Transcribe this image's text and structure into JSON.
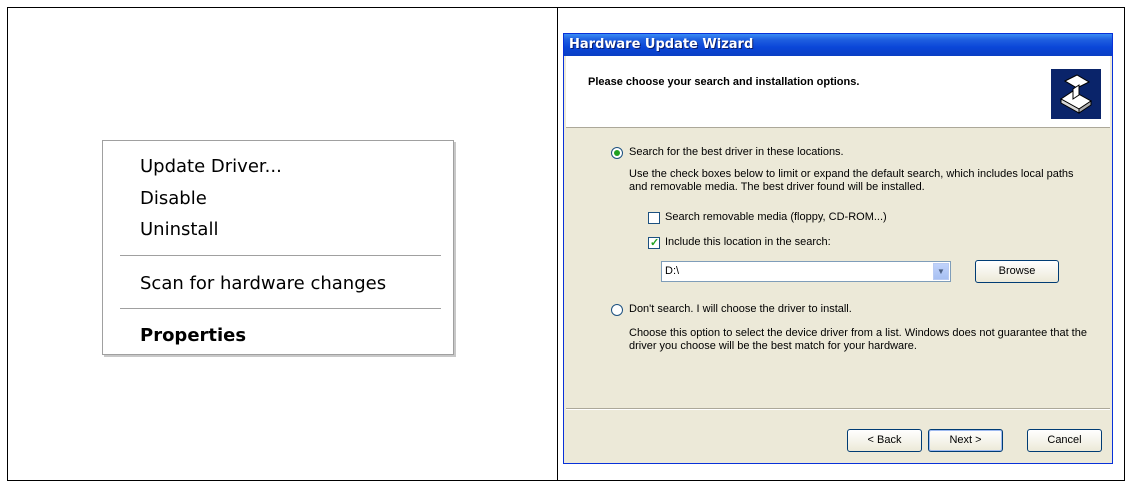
{
  "context_menu": {
    "items": [
      {
        "label": "Update Driver..."
      },
      {
        "label": "Disable"
      },
      {
        "label": "Uninstall"
      },
      {
        "label": "Scan for hardware changes"
      },
      {
        "label": "Properties"
      }
    ]
  },
  "wizard": {
    "title": "Hardware Update Wizard",
    "header": "Please choose your search and installation options.",
    "header_icon": "hardware-install-icon",
    "option_search": {
      "label": "Search for the best driver in these locations.",
      "selected": true,
      "description": "Use the check boxes below to limit or expand the default search, which includes local paths and removable media. The best driver found will be installed."
    },
    "checkbox_removable": {
      "label": "Search removable media (floppy, CD-ROM...)",
      "checked": false
    },
    "checkbox_location": {
      "label": "Include this location in the search:",
      "checked": true
    },
    "location_path": "D:\\",
    "browse_label": "Browse",
    "option_manual": {
      "label": "Don't search. I will choose the driver to install.",
      "selected": false,
      "description": "Choose this option to select the device driver from a list.  Windows does not guarantee that the driver you choose will be the best match for your hardware."
    },
    "buttons": {
      "back": "< Back",
      "next": "Next >",
      "cancel": "Cancel"
    },
    "colors": {
      "titlebar": "#0a46d8",
      "dialog_bg": "#ece9d8",
      "radio_dot": "#21a121"
    }
  }
}
